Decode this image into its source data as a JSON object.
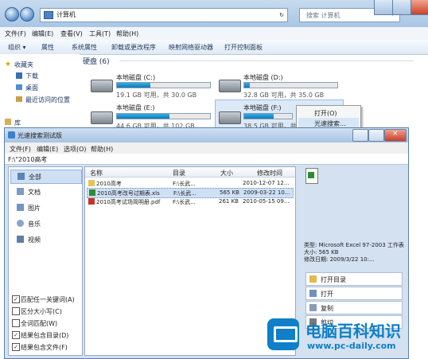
{
  "explorer": {
    "address": "计算机",
    "search_placeholder": "搜索 计算机",
    "menu": [
      "文件(F)",
      "编辑(E)",
      "查看(V)",
      "工具(T)",
      "帮助(H)"
    ],
    "toolbar": [
      "组织 ▾",
      "属性",
      "系统属性",
      "卸载或更改程序",
      "映射网络驱动器",
      "打开控制面板"
    ],
    "sidebar": {
      "favorites": "收藏夹",
      "downloads": "下载",
      "desktop": "桌面",
      "recent": "最近访问的位置",
      "library": "库"
    },
    "group_title": "硬盘 (6)",
    "drives": [
      {
        "name": "本地磁盘 (C:)",
        "size": "19.1 GB 可用，共 30.0 GB",
        "used": 0.36
      },
      {
        "name": "本地磁盘 (D:)",
        "size": "32.8 GB 可用，共 35.0 GB",
        "used": 0.06
      },
      {
        "name": "本地磁盘 (E:)",
        "size": "44.6 GB 可用，共 102 GB",
        "used": 0.56
      },
      {
        "name": "本地磁盘 (F:)",
        "size": "38.5 GB 可用，共 102 GB",
        "used": 0.62
      }
    ],
    "context_menu": [
      "打开(O)",
      "光速搜索..."
    ]
  },
  "tool": {
    "title": "光速搜索测试版",
    "menu": [
      "文件(F)",
      "编辑(E)",
      "选项(O)",
      "帮助(H)"
    ],
    "path": "F:\\\"2010高考",
    "categories": [
      "全部",
      "文档",
      "图片",
      "音乐",
      "视频"
    ],
    "options": [
      {
        "label": "匹配任一关键词(A)",
        "checked": true
      },
      {
        "label": "区分大小写(C)",
        "checked": false
      },
      {
        "label": "全词匹配(W)",
        "checked": false
      },
      {
        "label": "结果包含目录(D)",
        "checked": true
      },
      {
        "label": "结果包含文件(F)",
        "checked": true
      }
    ],
    "columns": [
      "名称",
      "目录",
      "大小",
      "修改时间"
    ],
    "rows": [
      {
        "name": "2010高考",
        "dir": "F:\\长武...",
        "size": "",
        "time": "2010-12-07 12..."
      },
      {
        "name": "2010高考改号过期表.xls",
        "dir": "F:\\长武...",
        "size": "565 KB",
        "time": "2009-03-22 10..."
      },
      {
        "name": "2010高考试场简明册.pdf",
        "dir": "F:\\长武...",
        "size": "261 KB",
        "time": "2010-05-15 09..."
      }
    ],
    "detail": {
      "type": "类型: Microsoft Excel 97-2003 工作表",
      "size": "大小: 565 KB",
      "modified": "修改日期: 2009/3/22 10:..."
    },
    "actions": [
      "打开目录",
      "打开",
      "复制",
      "剪切"
    ]
  },
  "watermark": {
    "title": "电脑百科知识",
    "url": "www.pc-daily.com"
  }
}
